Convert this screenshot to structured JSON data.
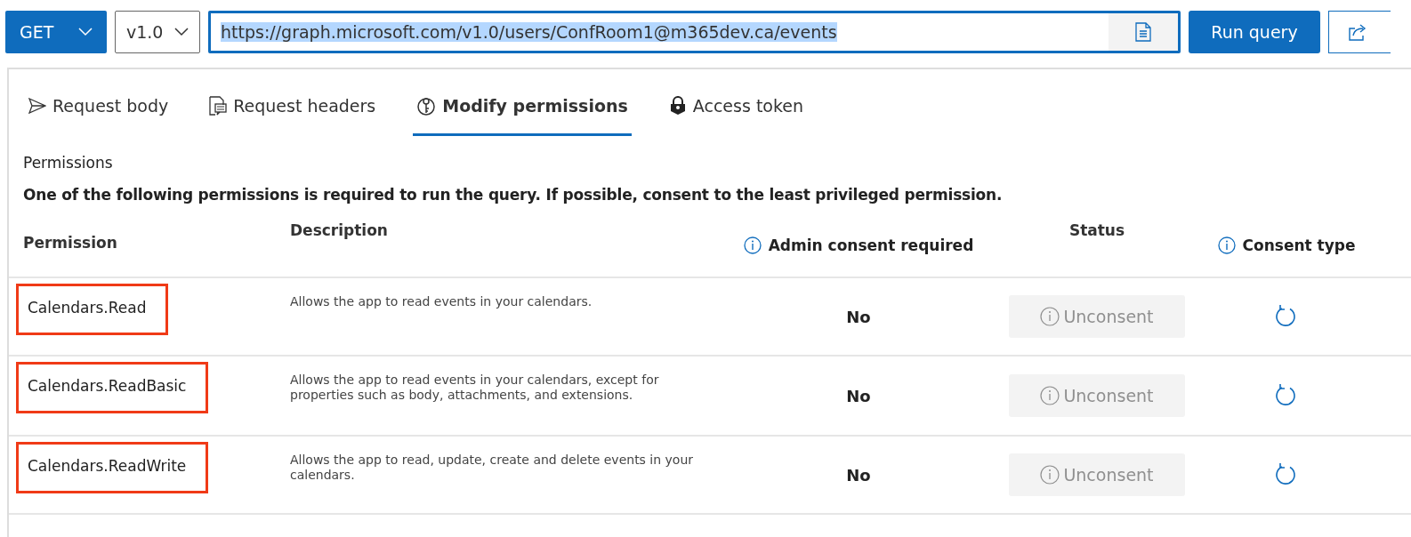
{
  "request": {
    "method": "GET",
    "version": "v1.0",
    "url": "https://graph.microsoft.com/v1.0/users/ConfRoom1@m365dev.ca/events",
    "url_selected": true,
    "run_label": "Run query"
  },
  "tabs": [
    {
      "label": "Request body",
      "kind": "send",
      "selected": false
    },
    {
      "label": "Request headers",
      "kind": "headers",
      "selected": false
    },
    {
      "label": "Modify permissions",
      "kind": "permissions",
      "selected": true
    },
    {
      "label": "Access token",
      "kind": "token",
      "selected": false
    }
  ],
  "permissions": {
    "title": "Permissions",
    "note": "One of the following permissions is required to run the query. If possible, consent to the least privileged permission.",
    "columns": [
      {
        "label": "Permission",
        "info": false
      },
      {
        "label": "Description",
        "info": false
      },
      {
        "label": "Admin consent required",
        "info": true
      },
      {
        "label": "Status",
        "info": false
      },
      {
        "label": "Consent type",
        "info": true
      }
    ],
    "rows": [
      {
        "name": "Calendars.Read",
        "highlighted": true,
        "description": "Allows the app to read events in your calendars.",
        "admin_consent": "No",
        "action": "Unconsent",
        "disabled": true
      },
      {
        "name": "Calendars.ReadBasic",
        "highlighted": true,
        "description": "Allows the app to read events in your calendars, except for properties such as body, attachments, and extensions.",
        "admin_consent": "No",
        "action": "Unconsent",
        "disabled": true
      },
      {
        "name": "Calendars.ReadWrite",
        "highlighted": true,
        "description": "Allows the app to read, update, create and delete events in your calendars.",
        "admin_consent": "No",
        "action": "Unconsent",
        "disabled": true
      }
    ]
  }
}
